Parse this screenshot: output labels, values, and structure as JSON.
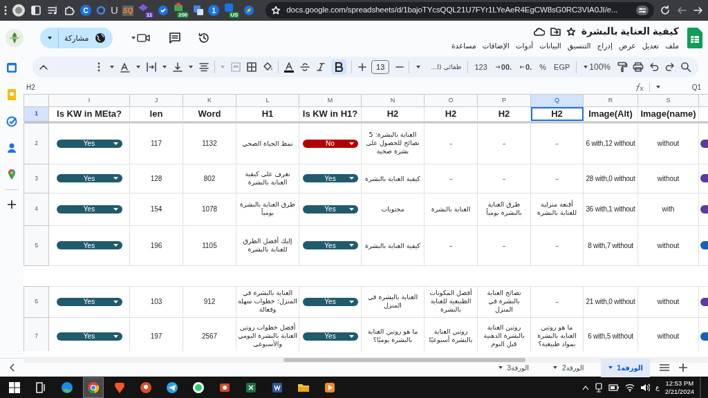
{
  "browser": {
    "extensions": [
      {
        "kind": "compass"
      },
      {
        "kind": "shield",
        "badge": "US"
      },
      {
        "kind": "letter-circle",
        "label": "1"
      },
      {
        "kind": "translate"
      },
      {
        "kind": "box",
        "badge": "200"
      },
      {
        "kind": "check"
      },
      {
        "kind": "hat",
        "badge": "11"
      },
      {
        "kind": "sq",
        "label": "SQ"
      },
      {
        "kind": "letter",
        "label": "U"
      },
      {
        "kind": "ring"
      },
      {
        "kind": "letter-circle",
        "label": "C"
      }
    ],
    "url": "docs.google.com/spreadsheets/d/1bajoTYcsQQL21U7FYr1LYeAeR4EgCW8sG0RC3VIA0JI/e..."
  },
  "doc": {
    "title": "كيفية العناية بالبشرة",
    "menu": [
      "ملف",
      "تعديل",
      "عرض",
      "إدراج",
      "التنسيق",
      "البيانات",
      "أدوات",
      "الإضافات",
      "مساعدة"
    ],
    "share_label": "مشاركة"
  },
  "toolbar": {
    "zoom": "100%",
    "currency": "EGP",
    "percent": "%",
    "decrease_decimals": ".0",
    "increase_decimals": ".00",
    "number_format": "123",
    "font": "طفائي (ا...",
    "font_size": "13",
    "bold": true
  },
  "formula_bar": {
    "name_box": "Q1",
    "content": "H2"
  },
  "columns": [
    {
      "letter": "S",
      "title": "Image(name)",
      "selected": false
    },
    {
      "letter": "R",
      "title": "Image(Alt)",
      "selected": false
    },
    {
      "letter": "Q",
      "title": "H2",
      "selected": true
    },
    {
      "letter": "P",
      "title": "H2",
      "selected": false
    },
    {
      "letter": "O",
      "title": "H2",
      "selected": false
    },
    {
      "letter": "N",
      "title": "H2",
      "selected": false
    },
    {
      "letter": "M",
      "title": "Is KW in H1?",
      "selected": false
    },
    {
      "letter": "L",
      "title": "H1",
      "selected": false
    },
    {
      "letter": "K",
      "title": "Word",
      "selected": false
    },
    {
      "letter": "J",
      "title": "len",
      "selected": false
    },
    {
      "letter": "I",
      "title": "Is KW in MEta?",
      "selected": false
    }
  ],
  "header_row": {
    "number": "1",
    "selected": true
  },
  "rows": [
    {
      "number": "2",
      "selected": false,
      "kw_in_meta": {
        "label": "Yes",
        "color": "#215a6c"
      },
      "len": "117",
      "word": "1132",
      "h1": "نمط الحياة الصحي",
      "kw_in_h1": {
        "label": "No",
        "color": "#b10202"
      },
      "h2": [
        "–",
        "–",
        "–",
        "العناية بالبشرة: 5 نصائح للحصول على بشرة صحية"
      ],
      "image_alt": "6 with,12 without",
      "image_name": "without",
      "column_t": {
        "color": "#5b3c9c"
      }
    },
    {
      "number": "3",
      "selected": false,
      "kw_in_meta": {
        "label": "Yes",
        "color": "#215a6c"
      },
      "len": "128",
      "word": "802",
      "h1": "تعرف على كيفية العناية بالبشرة",
      "kw_in_h1": {
        "label": "Yes",
        "color": "#215a6c"
      },
      "h2": [
        "–",
        "–",
        "–",
        "كيفية العناية بالبشرة"
      ],
      "image_alt": "28 with,0 without",
      "image_name": "without",
      "column_t": {
        "color": "#5b3c9c"
      }
    },
    {
      "number": "4",
      "selected": false,
      "kw_in_meta": {
        "label": "Yes",
        "color": "#215a6c"
      },
      "len": "154",
      "word": "1078",
      "h1": "طرق العناية بالبشرة يومياً",
      "kw_in_h1": {
        "label": "Yes",
        "color": "#215a6c"
      },
      "h2": [
        "أقنعة منزلية للعناية بالبشرة",
        "طرق العناية بالبشرة يومياً",
        "العناية بالبشرة",
        "محتويات"
      ],
      "image_alt": "36 with,1 without",
      "image_name": "with",
      "column_t": {
        "color": "#5b3c9c"
      }
    },
    {
      "number": "5",
      "selected": false,
      "kw_in_meta": {
        "label": "Yes",
        "color": "#215a6c"
      },
      "len": "196",
      "word": "1105",
      "h1": "إليك أفضل الطرق للعناية بالبشرة",
      "kw_in_h1": {
        "label": "Yes",
        "color": "#215a6c"
      },
      "h2": [
        "–",
        "–",
        "–",
        "كيفية العناية بالبشرة"
      ],
      "image_alt": "8 with,7 without",
      "image_name": "without",
      "column_t": {
        "color": "#1a5fb4"
      }
    },
    {
      "number": "6",
      "selected": false,
      "kw_in_meta": {
        "label": "Yes",
        "color": "#215a6c"
      },
      "len": "103",
      "word": "912",
      "h1": "العناية بالبشرة في المنزل: خطوات سهلة وفعالة",
      "kw_in_h1": {
        "label": "Yes",
        "color": "#215a6c"
      },
      "h2": [
        "–",
        "نصائح العناية بالبشرة في المنزل",
        "أفضل المكونات الطبيعية للعناية بالبشرة",
        "العناية بالبشرة في المنزل"
      ],
      "image_alt": "21 with,0 without",
      "image_name": "without",
      "column_t": {
        "color": "#5b3c9c"
      }
    },
    {
      "number": "7",
      "selected": false,
      "kw_in_meta": {
        "label": "Yes",
        "color": "#215a6c"
      },
      "len": "197",
      "word": "2567",
      "h1": "أفضل خطوات روتين العناية بالبشرة اليومي والأسبوعى",
      "kw_in_h1": {
        "label": "Yes",
        "color": "#215a6c"
      },
      "h2": [
        "ما هو روتين العناية بالبشرة بمواد طبيعية؟",
        "روتين العناية بالبشرة الدهنية قبل النوم",
        "روتين العناية بالبشرة أسبوعيًا",
        "ما هو روتين العناية بالبشرة يوميًا؟"
      ],
      "image_alt": "6 with,5 without",
      "image_name": "without",
      "column_t": {
        "color": "#1a5fb4"
      }
    }
  ],
  "sheets": [
    {
      "label": "الورقة1",
      "selected": true
    },
    {
      "label": "الورقة2",
      "selected": false
    },
    {
      "label": "الورقة3",
      "selected": false
    }
  ],
  "taskbar": {
    "language": "ع",
    "time": "12:53 PM",
    "date": "2/21/2024"
  }
}
